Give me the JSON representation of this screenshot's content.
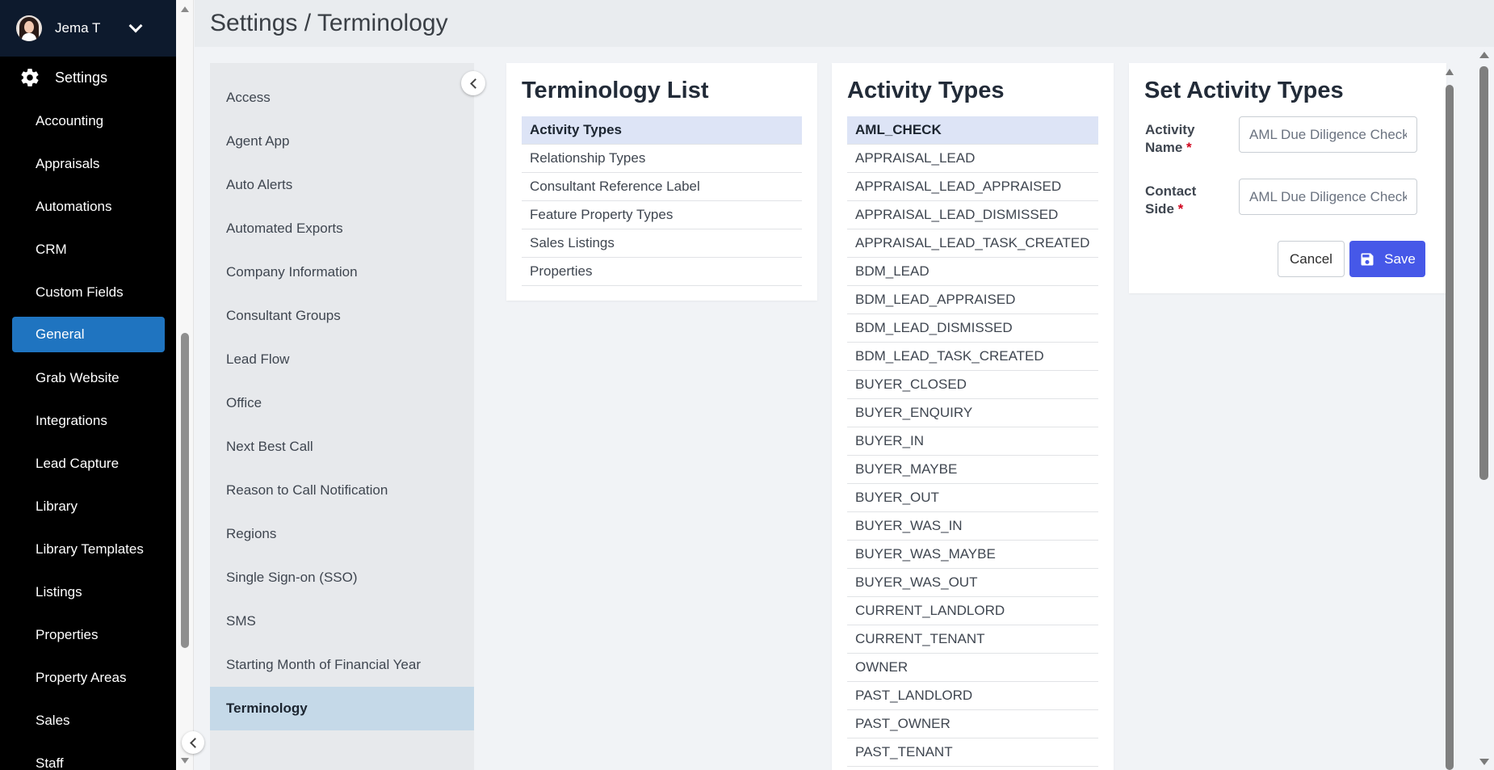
{
  "user": {
    "name": "Jema T"
  },
  "nav": {
    "settings_label": "Settings",
    "items": [
      {
        "label": "Accounting"
      },
      {
        "label": "Appraisals"
      },
      {
        "label": "Automations"
      },
      {
        "label": "CRM"
      },
      {
        "label": "Custom Fields"
      },
      {
        "label": "General",
        "active": true
      },
      {
        "label": "Grab Website"
      },
      {
        "label": "Integrations"
      },
      {
        "label": "Lead Capture"
      },
      {
        "label": "Library"
      },
      {
        "label": "Library Templates"
      },
      {
        "label": "Listings"
      },
      {
        "label": "Properties"
      },
      {
        "label": "Property Areas"
      },
      {
        "label": "Sales"
      },
      {
        "label": "Staff"
      }
    ]
  },
  "header": {
    "title": "Settings / Terminology"
  },
  "submenu": {
    "items": [
      {
        "label": "Access"
      },
      {
        "label": "Agent App"
      },
      {
        "label": "Auto Alerts"
      },
      {
        "label": "Automated Exports"
      },
      {
        "label": "Company Information"
      },
      {
        "label": "Consultant Groups"
      },
      {
        "label": "Lead Flow"
      },
      {
        "label": "Office"
      },
      {
        "label": "Next Best Call"
      },
      {
        "label": "Reason to Call Notification"
      },
      {
        "label": "Regions"
      },
      {
        "label": "Single Sign-on (SSO)"
      },
      {
        "label": "SMS"
      },
      {
        "label": "Starting Month of Financial Year"
      },
      {
        "label": "Terminology",
        "active": true
      }
    ]
  },
  "terminology_list": {
    "title": "Terminology List",
    "items": [
      {
        "label": "Activity Types",
        "active": true
      },
      {
        "label": "Relationship Types"
      },
      {
        "label": "Consultant Reference Label"
      },
      {
        "label": "Feature Property Types"
      },
      {
        "label": "Sales Listings"
      },
      {
        "label": "Properties"
      }
    ]
  },
  "activity_types": {
    "title": "Activity Types",
    "items": [
      {
        "label": "AML_CHECK",
        "active": true
      },
      {
        "label": "APPRAISAL_LEAD"
      },
      {
        "label": "APPRAISAL_LEAD_APPRAISED"
      },
      {
        "label": "APPRAISAL_LEAD_DISMISSED"
      },
      {
        "label": "APPRAISAL_LEAD_TASK_CREATED"
      },
      {
        "label": "BDM_LEAD"
      },
      {
        "label": "BDM_LEAD_APPRAISED"
      },
      {
        "label": "BDM_LEAD_DISMISSED"
      },
      {
        "label": "BDM_LEAD_TASK_CREATED"
      },
      {
        "label": "BUYER_CLOSED"
      },
      {
        "label": "BUYER_ENQUIRY"
      },
      {
        "label": "BUYER_IN"
      },
      {
        "label": "BUYER_MAYBE"
      },
      {
        "label": "BUYER_OUT"
      },
      {
        "label": "BUYER_WAS_IN"
      },
      {
        "label": "BUYER_WAS_MAYBE"
      },
      {
        "label": "BUYER_WAS_OUT"
      },
      {
        "label": "CURRENT_LANDLORD"
      },
      {
        "label": "CURRENT_TENANT"
      },
      {
        "label": "OWNER"
      },
      {
        "label": "PAST_LANDLORD"
      },
      {
        "label": "PAST_OWNER"
      },
      {
        "label": "PAST_TENANT"
      }
    ]
  },
  "set_form": {
    "title": "Set Activity Types",
    "activity_name_label_1": "Activity",
    "activity_name_label_2": "Name",
    "activity_name_value": "AML Due Diligence Check",
    "contact_side_label_1": "Contact",
    "contact_side_label_2": "Side",
    "contact_side_value": "AML Due Diligence Check",
    "required_mark": "*",
    "cancel_label": "Cancel",
    "save_label": "Save"
  },
  "colors": {
    "nav_bg": "#000000",
    "nav_active": "#1f74c0",
    "save_button": "#4658e8",
    "list_active": "#dde4f6",
    "submenu_active": "#c5d9e8",
    "required": "#d0021b"
  }
}
